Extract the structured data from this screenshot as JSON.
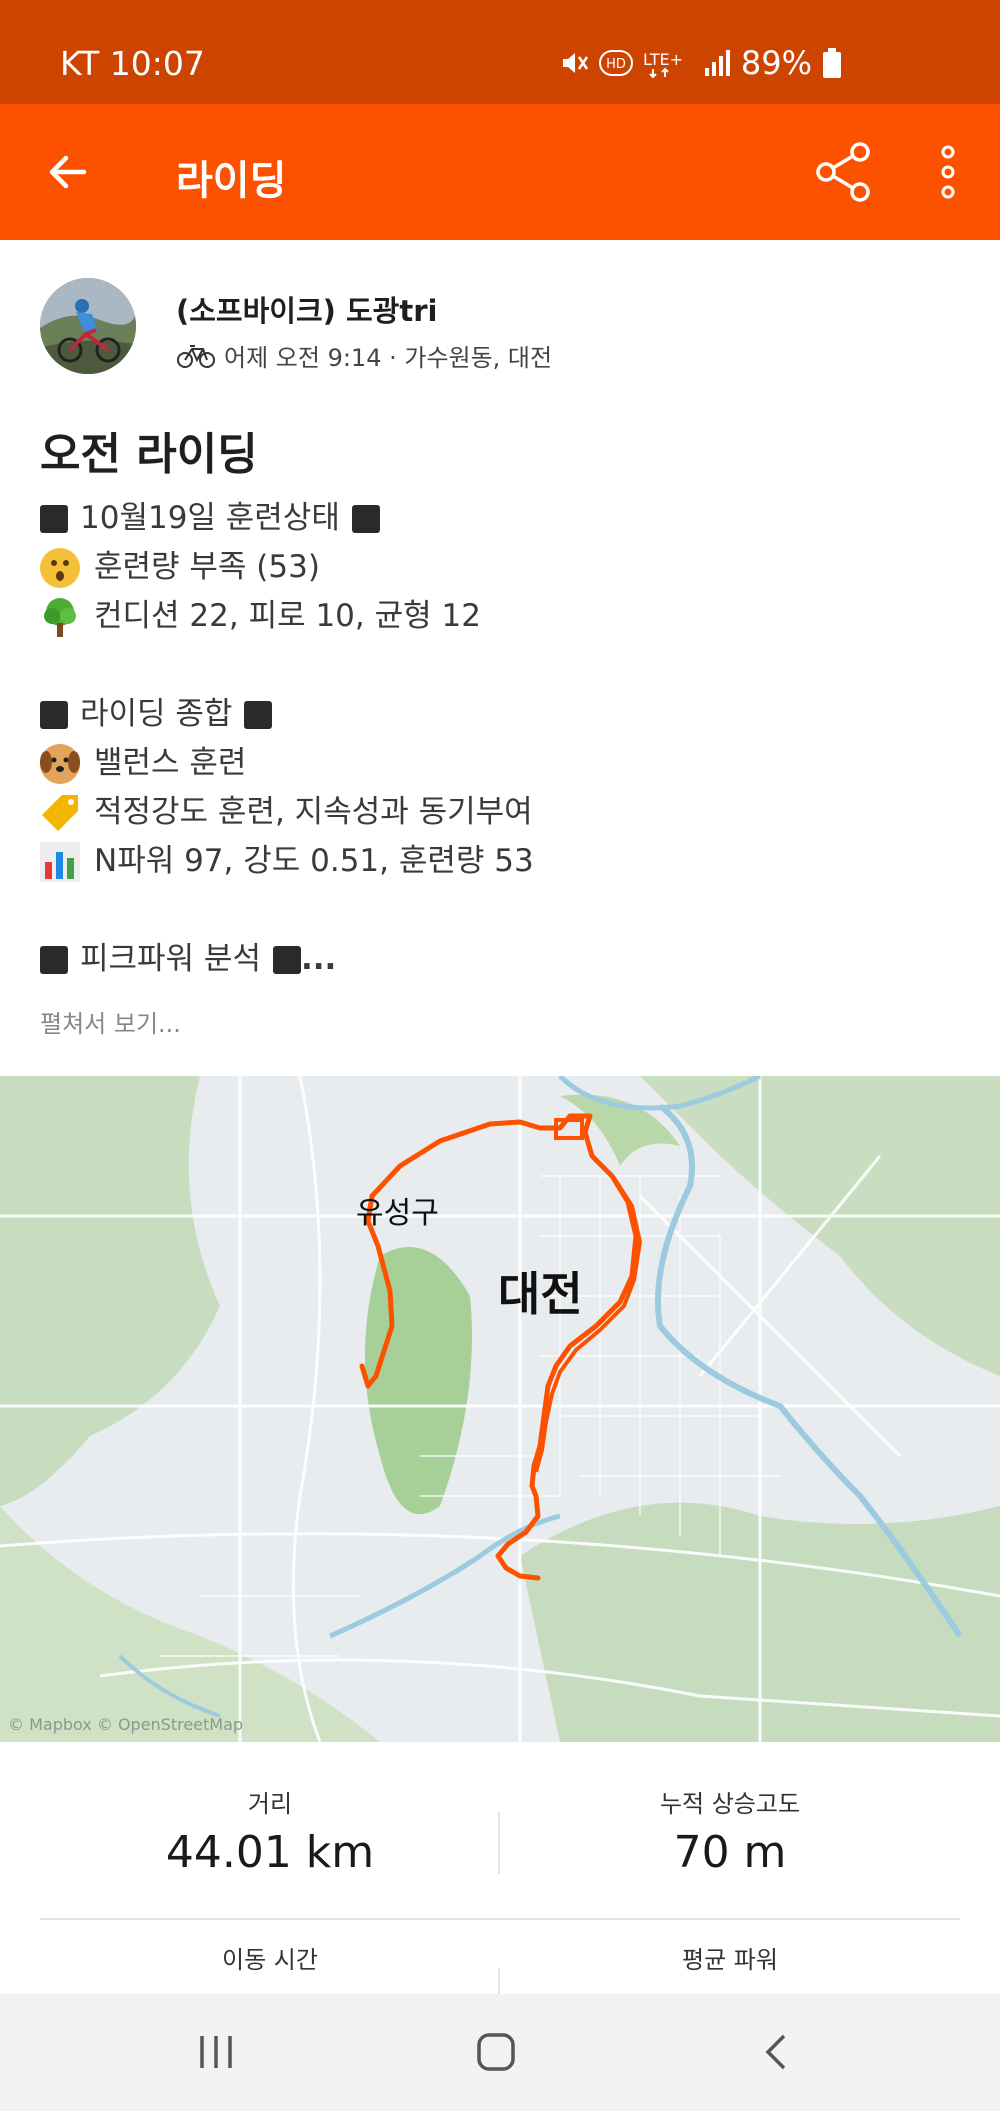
{
  "status_bar": {
    "carrier_time": "KT 10:07",
    "battery": "89%"
  },
  "app_bar": {
    "title": "라이딩"
  },
  "athlete": {
    "name": "(소프바이크) 도광tri",
    "meta": "어제 오전 9:14 · 가수원동, 대전"
  },
  "activity": {
    "title": "오전 라이딩"
  },
  "description": {
    "training_header": "10월19일 훈련상태",
    "training_load": "훈련량 부족 (53)",
    "condition": "컨디션 22, 피로 10, 균형 12",
    "ride_header": "라이딩 종합",
    "balance": "밸런스 훈련",
    "tag": "적정강도 훈련, 지속성과 동기부여",
    "power": "N파워 97, 강도 0.51, 훈련량 53",
    "peak_header": "피크파워 분석",
    "ellipsis": "...",
    "expand": "펼쳐서 보기..."
  },
  "map": {
    "city": "대전",
    "district": "유성구",
    "attribution": "© Mapbox © OpenStreetMap",
    "route_color": "#fc5200"
  },
  "stats": {
    "distance_label": "거리",
    "distance_value": "44.01 km",
    "elevation_label": "누적 상승고도",
    "elevation_value": "70 m",
    "moving_time_label": "이동 시간",
    "avg_power_label": "평균 파워"
  },
  "colors": {
    "brand": "#fc5200",
    "status": "#cc4400"
  }
}
